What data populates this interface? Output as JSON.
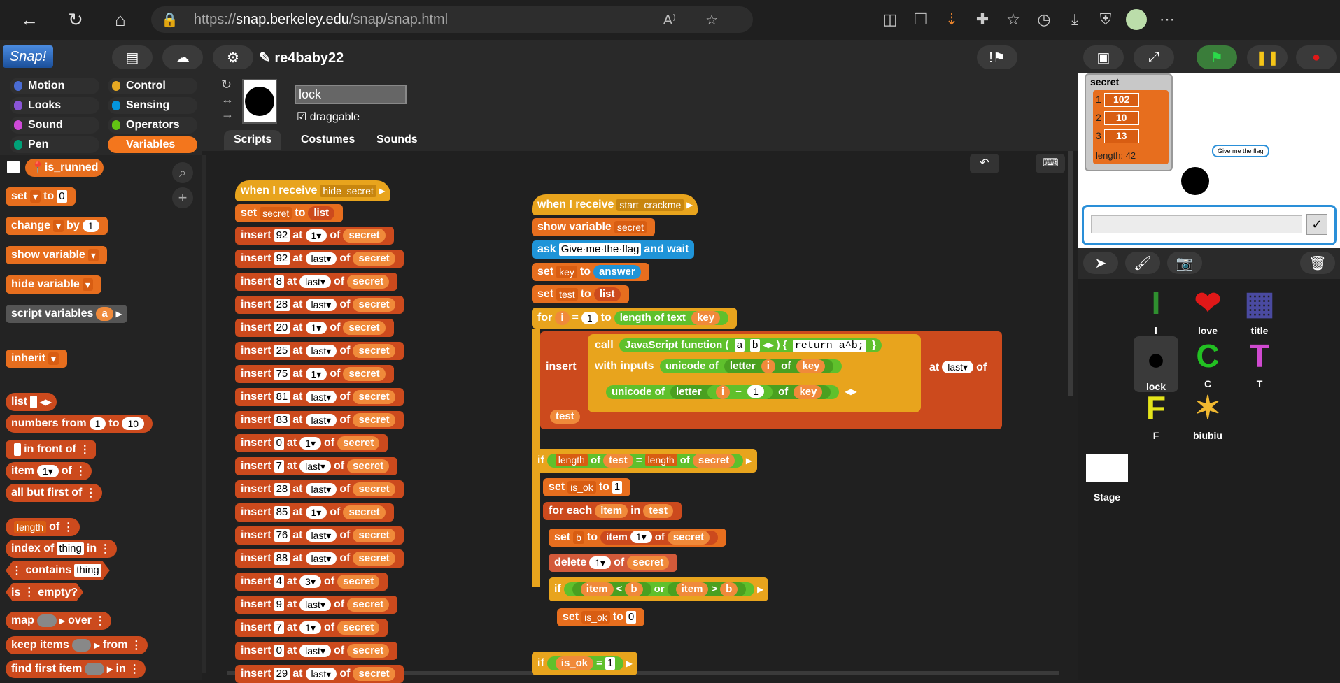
{
  "browser": {
    "url_prefix": "https://",
    "url_host": "snap.berkeley.edu",
    "url_path": "/snap/snap.html"
  },
  "app": {
    "project_name": "re4baby22",
    "logo": "Snap!"
  },
  "categories": [
    "Motion",
    "Control",
    "Looks",
    "Sensing",
    "Sound",
    "Operators",
    "Pen",
    "Variables"
  ],
  "sprite": {
    "name": "lock",
    "draggable_label": "draggable",
    "tabs": [
      "Scripts",
      "Costumes",
      "Sounds"
    ]
  },
  "palette": {
    "var": "is_runned",
    "set": "set",
    "to": "to",
    "to_val": "0",
    "change": "change",
    "by": "by",
    "by_val": "1",
    "show_var": "show variable",
    "hide_var": "hide variable",
    "script_vars": "script variables",
    "script_vars_val": "a",
    "inherit": "inherit",
    "list": "list",
    "numbers_from": "numbers from",
    "num_from_val": "1",
    "num_to": "to",
    "num_to_val": "10",
    "in_front_of": "in front of",
    "item": "item",
    "item_val": "1",
    "item_of": "of",
    "all_but_first": "all but first of",
    "length": "length",
    "length_of": "of",
    "index_of": "index of",
    "index_thing": "thing",
    "index_in": "in",
    "contains": "contains",
    "contains_thing": "thing",
    "is_empty": "is ⋮ empty?",
    "map": "map",
    "map_over": "over",
    "keep": "keep items",
    "keep_from": "from",
    "find": "find first item",
    "find_in": "in"
  },
  "script1": {
    "hat": "when I receive",
    "msg": "hide_secret",
    "set": "set",
    "set_var": "secret",
    "set_to": "to",
    "set_list": "list",
    "inserts": [
      {
        "v": "92",
        "at": "1"
      },
      {
        "v": "92",
        "at": "last"
      },
      {
        "v": "8",
        "at": "last"
      },
      {
        "v": "28",
        "at": "last"
      },
      {
        "v": "20",
        "at": "1"
      },
      {
        "v": "25",
        "at": "last"
      },
      {
        "v": "75",
        "at": "1"
      },
      {
        "v": "81",
        "at": "last"
      },
      {
        "v": "83",
        "at": "last"
      },
      {
        "v": "0",
        "at": "1"
      },
      {
        "v": "7",
        "at": "last"
      },
      {
        "v": "28",
        "at": "last"
      },
      {
        "v": "85",
        "at": "1"
      },
      {
        "v": "76",
        "at": "last"
      },
      {
        "v": "88",
        "at": "last"
      },
      {
        "v": "4",
        "at": "3"
      },
      {
        "v": "9",
        "at": "last"
      },
      {
        "v": "7",
        "at": "1"
      },
      {
        "v": "0",
        "at": "last"
      },
      {
        "v": "29",
        "at": "last"
      }
    ],
    "insert": "insert",
    "at": "at",
    "of": "of",
    "target": "secret"
  },
  "script2": {
    "hat": "when I receive",
    "msg": "start_crackme",
    "show_var": "show variable",
    "show_var_val": "secret",
    "ask": "ask",
    "ask_val": "Give·me·the·flag",
    "ask_wait": "and wait",
    "set_key": "set",
    "key": "key",
    "to": "to",
    "answer": "answer",
    "set_test": "test",
    "list": "list",
    "for": "for",
    "i": "i",
    "eq": "=",
    "one": "1",
    "length_text": "length of text",
    "insert": "insert",
    "call": "call",
    "js": "JavaScript function",
    "js_a": "a",
    "js_b": "b",
    "js_code": "return a^b;",
    "with_inputs": "with inputs",
    "unicode_of": "unicode of",
    "letter": "letter",
    "minus": "−",
    "of": "of",
    "at": "at",
    "last": "last",
    "test": "test",
    "if": "if",
    "length": "length",
    "secret": "secret",
    "set_isok": "is_ok",
    "isok_val": "1",
    "for_each": "for each",
    "item": "item",
    "in": "in",
    "set_b": "b",
    "item1": "1",
    "delete": "delete",
    "lt": "<",
    "or": "or",
    "gt": ">",
    "isok_zero": "0"
  },
  "stage": {
    "watcher_title": "secret",
    "watcher_rows": [
      {
        "i": "1",
        "v": "102"
      },
      {
        "i": "2",
        "v": "10"
      },
      {
        "i": "3",
        "v": "13"
      }
    ],
    "watcher_length": "length: 42",
    "bubble": "Give me the flag"
  },
  "sprites": [
    {
      "name": "l"
    },
    {
      "name": "love"
    },
    {
      "name": "title"
    },
    {
      "name": "lock"
    },
    {
      "name": "C"
    },
    {
      "name": "T"
    },
    {
      "name": "F"
    },
    {
      "name": "biubiu"
    }
  ],
  "stage_label": "Stage"
}
